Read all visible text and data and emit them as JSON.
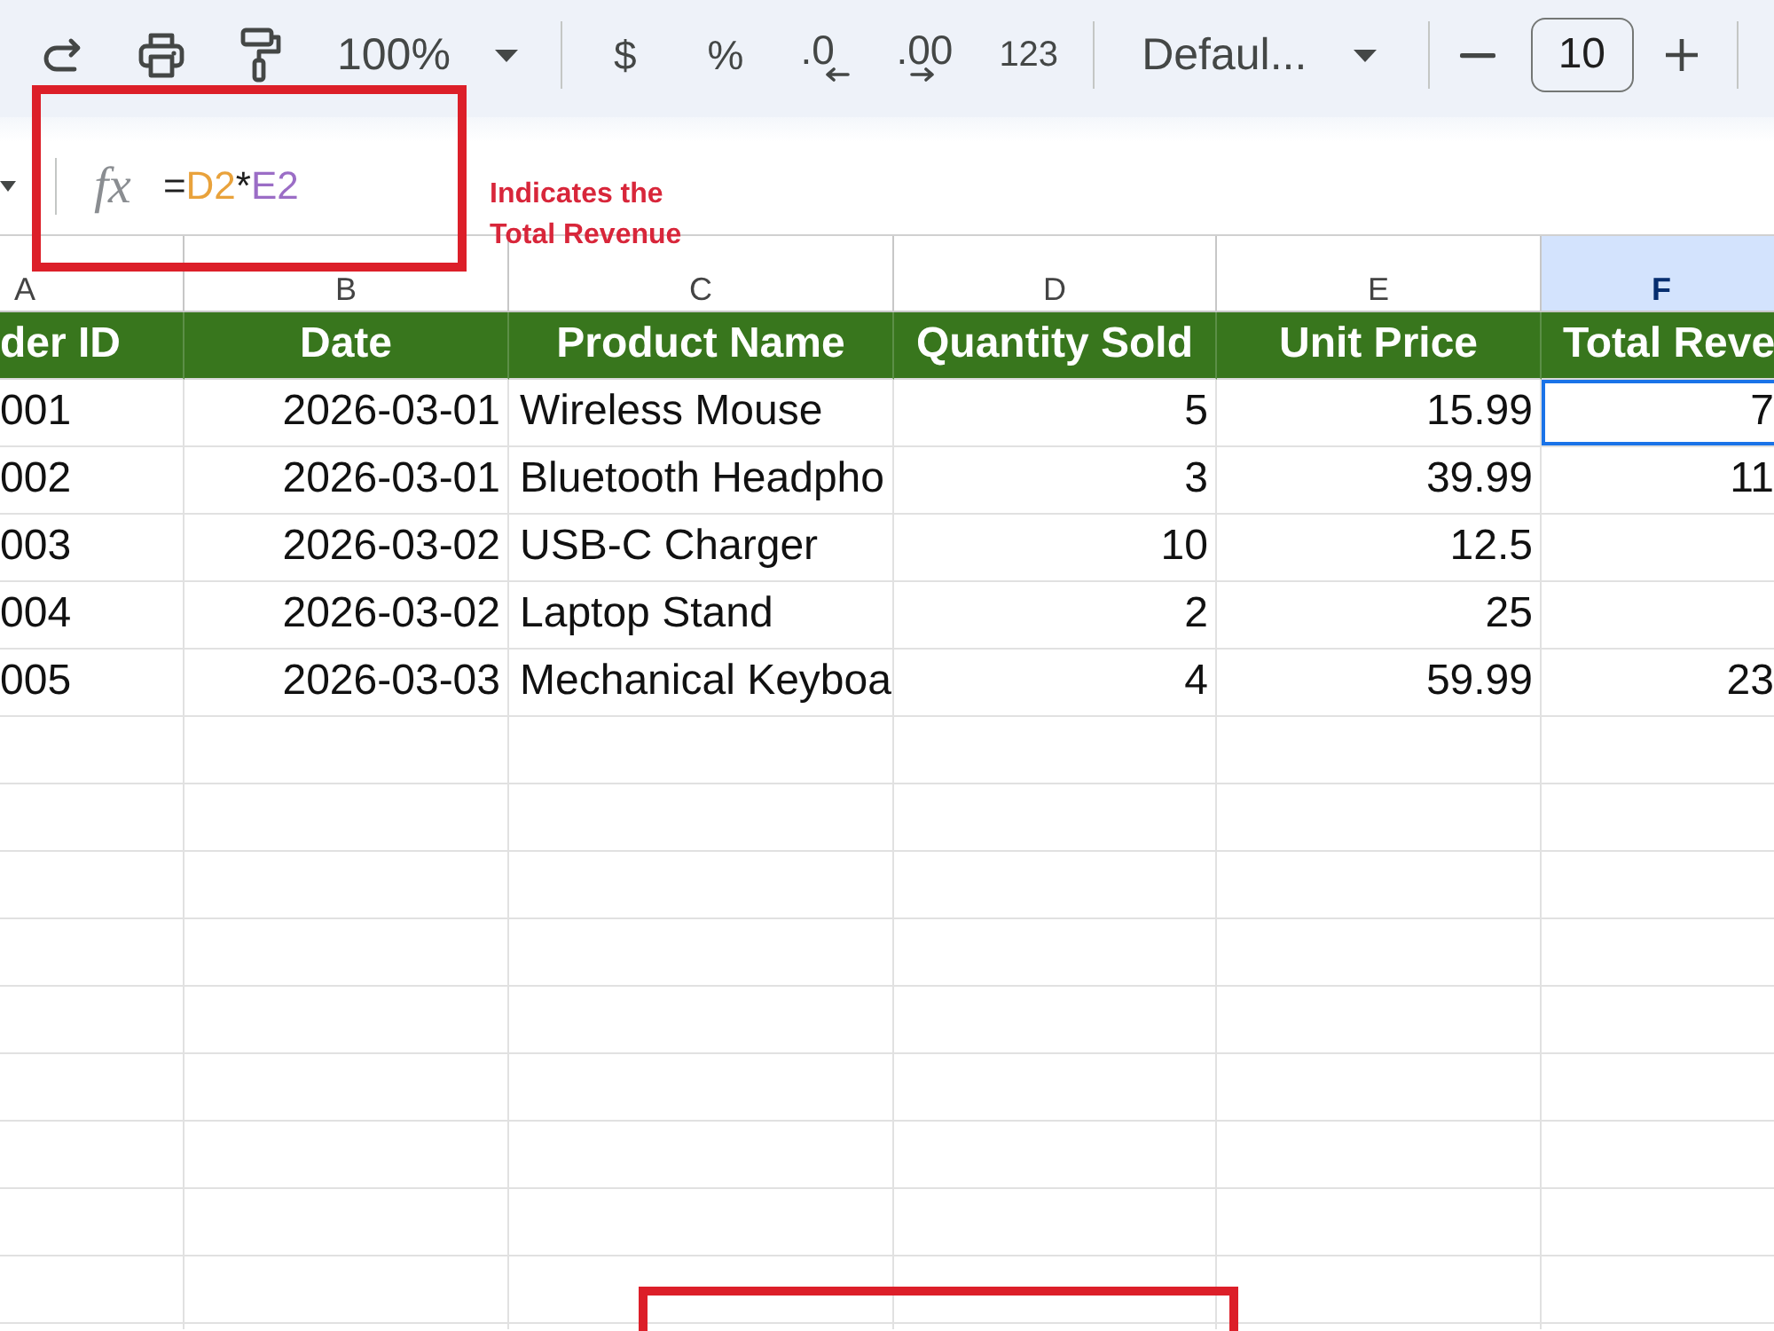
{
  "toolbar": {
    "zoom": "100%",
    "format_buttons": [
      {
        "kind": "currency",
        "label": "$"
      },
      {
        "kind": "percent",
        "label": "%"
      },
      {
        "kind": "decimal_decrease",
        "label": ".0"
      },
      {
        "kind": "decimal_increase",
        "label": ".00"
      },
      {
        "kind": "number_format",
        "label": "123"
      }
    ],
    "font": "Defaul...",
    "font_size": "10"
  },
  "formula_bar": {
    "label": "fx",
    "formula": [
      {
        "kind": "operator",
        "text": "="
      },
      {
        "kind": "reference",
        "text": "D2",
        "color": "#e9a23b"
      },
      {
        "kind": "operator",
        "text": "*"
      },
      {
        "kind": "reference",
        "text": "E2",
        "color": "#9b6dc6"
      }
    ]
  },
  "callout": {
    "text": "Indicates the Total Revenue"
  },
  "sheet": {
    "columns": [
      {
        "label": "A",
        "selected": false
      },
      {
        "label": "B",
        "selected": false
      },
      {
        "label": "C",
        "selected": false
      },
      {
        "label": "D",
        "selected": false
      },
      {
        "label": "E",
        "selected": false
      },
      {
        "label": "F",
        "selected": true
      }
    ],
    "header_row": [
      "der ID",
      "Date",
      "Product Name",
      "Quantity Sold",
      "Unit Price",
      "Total Reve"
    ],
    "rows": [
      {
        "cells": [
          {
            "text": "001",
            "selected": false
          },
          {
            "text": "2026-03-01",
            "selected": false
          },
          {
            "text": "Wireless Mouse",
            "selected": false
          },
          {
            "text": "5",
            "selected": false
          },
          {
            "text": "15.99",
            "selected": false
          },
          {
            "text": "7",
            "selected": true
          }
        ]
      },
      {
        "cells": [
          {
            "text": "002",
            "selected": false
          },
          {
            "text": "2026-03-01",
            "selected": false
          },
          {
            "text": "Bluetooth Headpho",
            "selected": false
          },
          {
            "text": "3",
            "selected": false
          },
          {
            "text": "39.99",
            "selected": false
          },
          {
            "text": "11",
            "selected": false
          }
        ]
      },
      {
        "cells": [
          {
            "text": "003",
            "selected": false
          },
          {
            "text": "2026-03-02",
            "selected": false
          },
          {
            "text": "USB-C Charger",
            "selected": false
          },
          {
            "text": "10",
            "selected": false
          },
          {
            "text": "12.5",
            "selected": false
          },
          {
            "selected": false
          }
        ]
      },
      {
        "cells": [
          {
            "text": "004",
            "selected": false
          },
          {
            "text": "2026-03-02",
            "selected": false
          },
          {
            "text": "Laptop Stand",
            "selected": false
          },
          {
            "text": "2",
            "selected": false
          },
          {
            "text": "25",
            "selected": false
          },
          {
            "selected": false
          }
        ]
      },
      {
        "cells": [
          {
            "text": "005",
            "selected": false
          },
          {
            "text": "2026-03-03",
            "selected": false
          },
          {
            "text": "Mechanical Keyboa",
            "selected": false
          },
          {
            "text": "4",
            "selected": false
          },
          {
            "text": "59.99",
            "selected": false
          },
          {
            "text": "23",
            "selected": false
          }
        ]
      }
    ]
  }
}
